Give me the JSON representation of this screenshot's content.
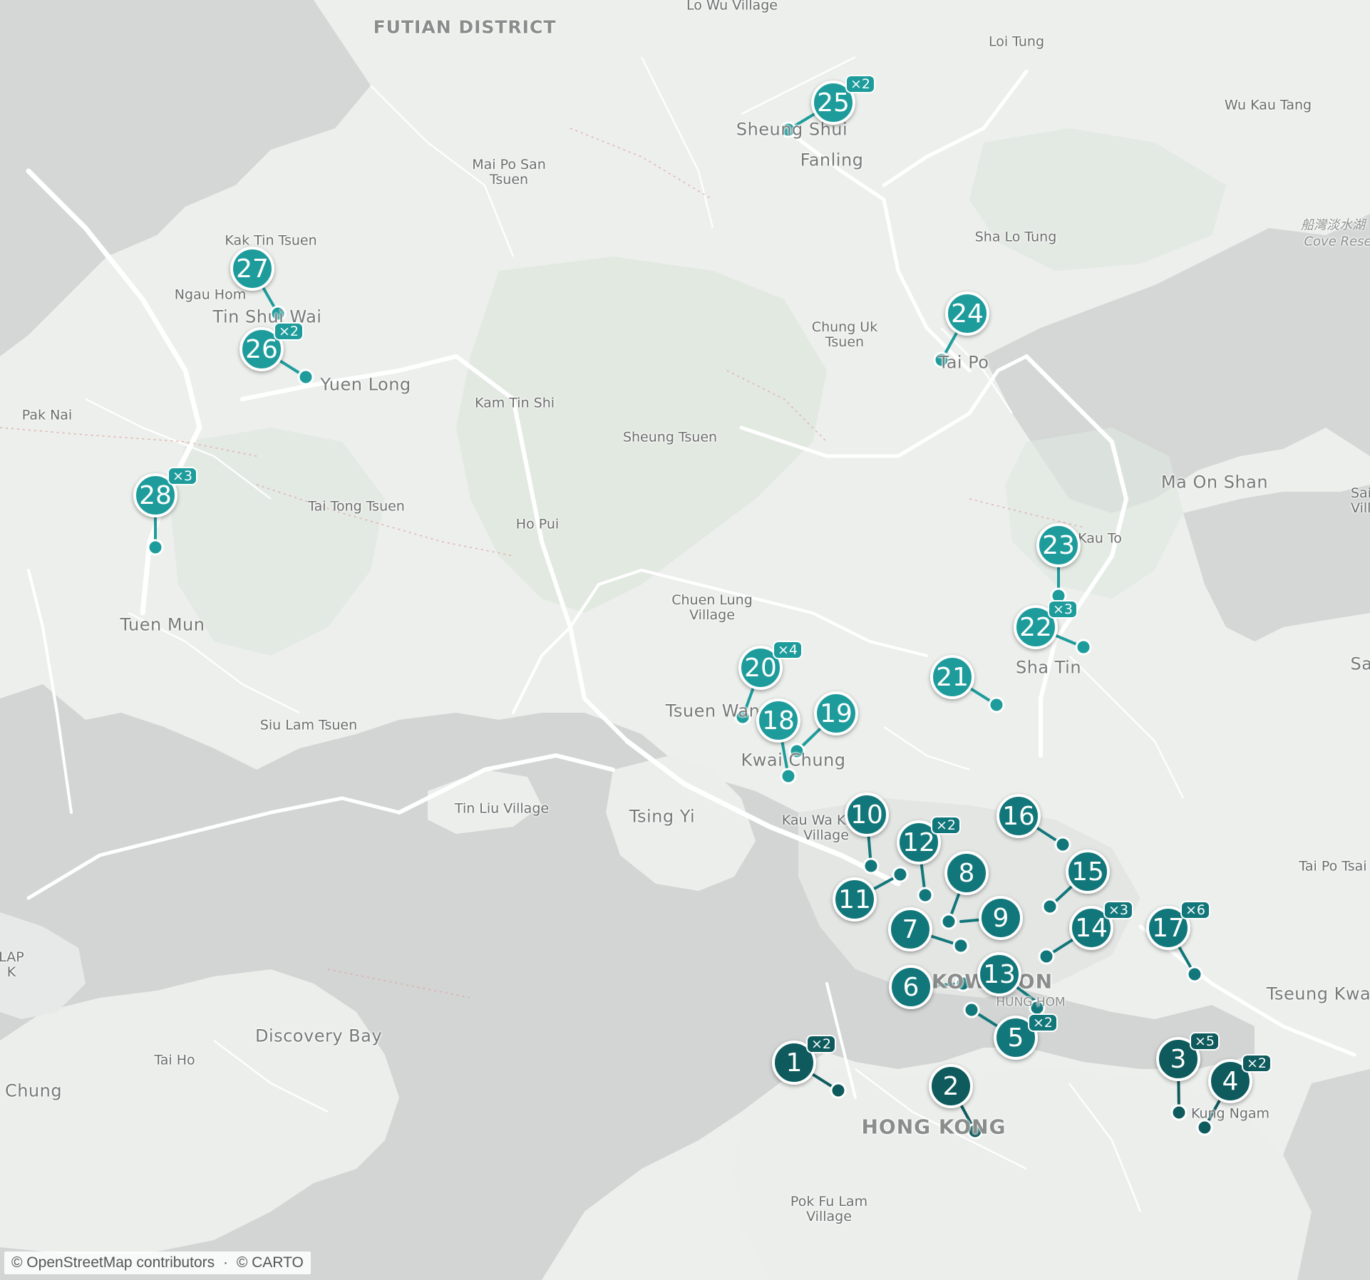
{
  "map": {
    "attribution": {
      "osm": "© OpenStreetMap contributors",
      "separator": "·",
      "carto": "© CARTO"
    },
    "colors": {
      "water": "#d2d5d4",
      "land": "#ecefec",
      "park": "#dfe6de",
      "road": "#ffffff",
      "marker_dark": "#0e5a5c",
      "marker_mid": "#12777a",
      "marker_light": "#1e9c9c"
    },
    "places": {
      "futian": "FUTIAN DISTRICT",
      "lo_wu": "Lo Wu Village",
      "loi_tung": "Loi Tung",
      "wu_kau_tang": "Wu Kau Tang",
      "sheung_shui": "Sheung Shui",
      "fanling": "Fanling",
      "mai_po": "Mai Po San\nTsuen",
      "sha_lo_tung": "Sha Lo Tung",
      "cove_zh": "船灣淡水湖",
      "cove_en": "Cove Rese",
      "kak_tin": "Kak Tin Tsuen",
      "ngau_hom": "Ngau Hom",
      "tin_shui_wai": "Tin Shui Wai",
      "chung_uk": "Chung Uk\nTsuen",
      "tai_po": "Tai Po",
      "yuen_long": "Yuen Long",
      "pak_nai": "Pak Nai",
      "kam_tin_shi": "Kam Tin Shi",
      "sheung_tsuen": "Sheung Tsuen",
      "ma_on_shan": "Ma On Shan",
      "sai_kung_villa": "Sai K\nVilla",
      "tai_tong": "Tai Tong Tsuen",
      "ho_pui": "Ho Pui",
      "kau_to": "Kau To",
      "tuen_mun": "Tuen Mun",
      "chuen_lung": "Chuen Lung\nVillage",
      "sha_tin": "Sha Tin",
      "sa": "Sa",
      "tsuen_wan": "Tsuen Wan",
      "siu_lam": "Siu Lam Tsuen",
      "kwai_chung": "Kwai Chung",
      "tin_liu": "Tin Liu Village",
      "tsing_yi": "Tsing Yi",
      "kau_wa_keng": "Kau Wa Keng\nVillage",
      "tai_po_tsai": "Tai Po Tsai",
      "lap": "LAP\nK",
      "kowloon": "KOWLOON",
      "hung_hom": "HUNG HOM",
      "tseung_kwan": "Tseung Kwa",
      "discovery_bay": "Discovery Bay",
      "tai_ho": "Tai Ho",
      "tung_chung": "Chung",
      "hong_kong": "HONG KONG",
      "kwun_ngam": "Kung Ngam",
      "pok_fu_lam": "Pok Fu Lam\nVillage"
    },
    "markers": [
      {
        "number": "1",
        "count": "×2",
        "tone": "dark"
      },
      {
        "number": "2",
        "count": "",
        "tone": "dark"
      },
      {
        "number": "3",
        "count": "×5",
        "tone": "dark"
      },
      {
        "number": "4",
        "count": "×2",
        "tone": "dark"
      },
      {
        "number": "5",
        "count": "×2",
        "tone": "mid"
      },
      {
        "number": "6",
        "count": "",
        "tone": "mid"
      },
      {
        "number": "7",
        "count": "",
        "tone": "mid"
      },
      {
        "number": "8",
        "count": "",
        "tone": "mid"
      },
      {
        "number": "9",
        "count": "",
        "tone": "mid"
      },
      {
        "number": "10",
        "count": "",
        "tone": "mid"
      },
      {
        "number": "11",
        "count": "",
        "tone": "mid"
      },
      {
        "number": "12",
        "count": "×2",
        "tone": "mid"
      },
      {
        "number": "13",
        "count": "",
        "tone": "mid"
      },
      {
        "number": "14",
        "count": "×3",
        "tone": "mid"
      },
      {
        "number": "15",
        "count": "",
        "tone": "mid"
      },
      {
        "number": "16",
        "count": "",
        "tone": "mid"
      },
      {
        "number": "17",
        "count": "×6",
        "tone": "mid"
      },
      {
        "number": "18",
        "count": "",
        "tone": "light"
      },
      {
        "number": "19",
        "count": "",
        "tone": "light"
      },
      {
        "number": "20",
        "count": "×4",
        "tone": "light"
      },
      {
        "number": "21",
        "count": "",
        "tone": "light"
      },
      {
        "number": "22",
        "count": "×3",
        "tone": "light"
      },
      {
        "number": "23",
        "count": "",
        "tone": "light"
      },
      {
        "number": "24",
        "count": "",
        "tone": "light"
      },
      {
        "number": "25",
        "count": "×2",
        "tone": "light"
      },
      {
        "number": "26",
        "count": "×2",
        "tone": "light"
      },
      {
        "number": "27",
        "count": "",
        "tone": "light"
      },
      {
        "number": "28",
        "count": "×3",
        "tone": "light"
      }
    ]
  }
}
